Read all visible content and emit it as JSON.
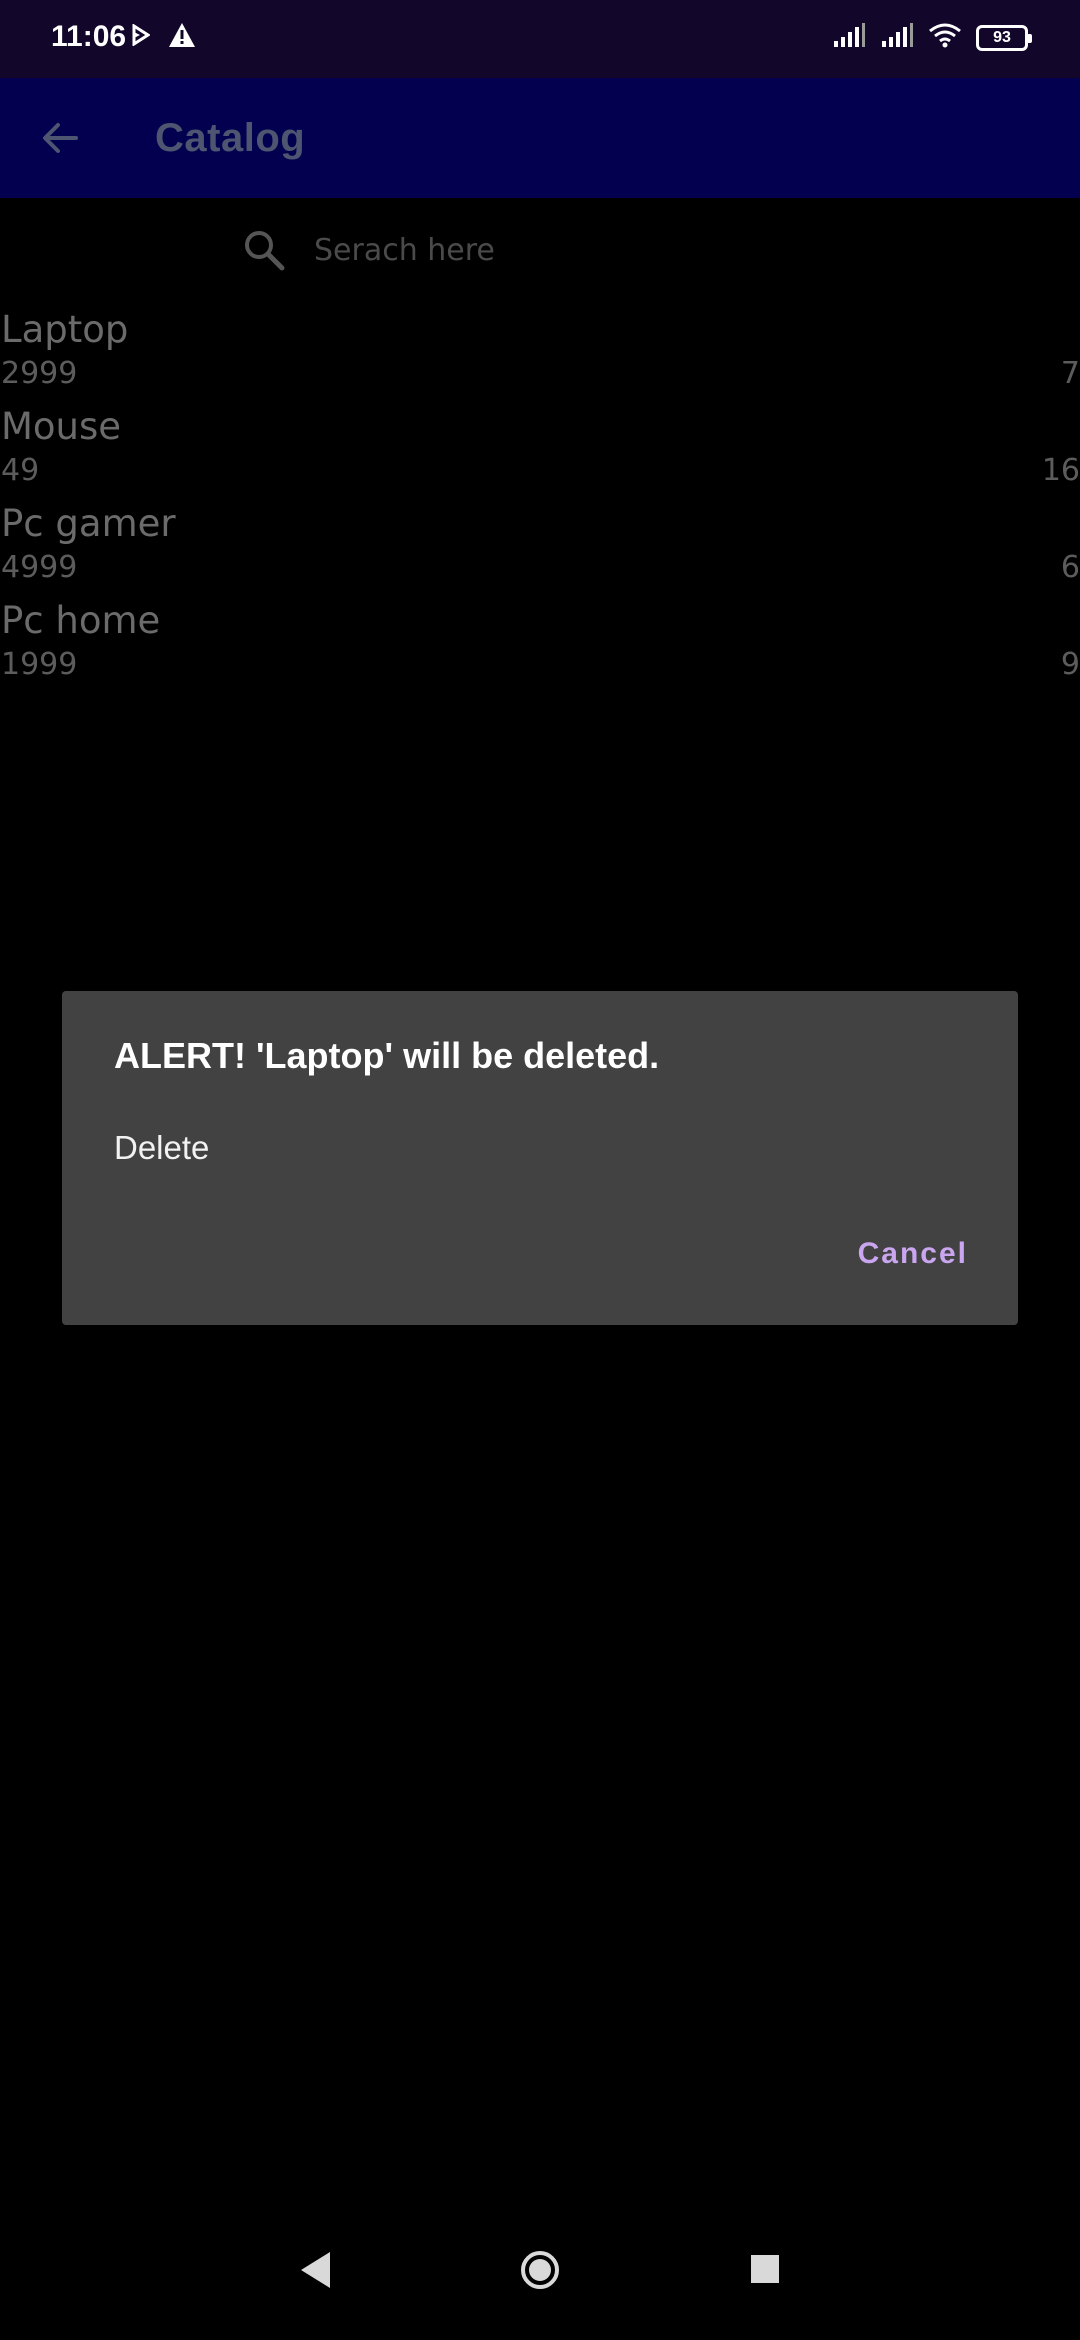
{
  "status_bar": {
    "time": "11:06",
    "battery_level": "93",
    "icons": [
      "play-icon",
      "warning-icon",
      "signal-icon",
      "signal-icon",
      "wifi-icon",
      "battery-icon"
    ]
  },
  "app_bar": {
    "title": "Catalog",
    "back_icon": "arrow-back-icon",
    "background_color": "#02004f"
  },
  "search": {
    "placeholder": "Serach here",
    "value": ""
  },
  "catalog": {
    "items": [
      {
        "name": "Laptop",
        "price": "2999",
        "quantity": "7"
      },
      {
        "name": "Mouse",
        "price": "49",
        "quantity": "16"
      },
      {
        "name": "Pc gamer",
        "price": "4999",
        "quantity": "6"
      },
      {
        "name": "Pc home",
        "price": "1999",
        "quantity": "9"
      }
    ]
  },
  "dialog": {
    "title": "ALERT! 'Laptop' will be deleted.",
    "option_delete": "Delete",
    "cancel_label": "Cancel",
    "accent_color": "#caa6f0"
  },
  "nav_bar": {
    "icons": [
      "nav-back-icon",
      "nav-home-icon",
      "nav-recents-icon"
    ]
  }
}
